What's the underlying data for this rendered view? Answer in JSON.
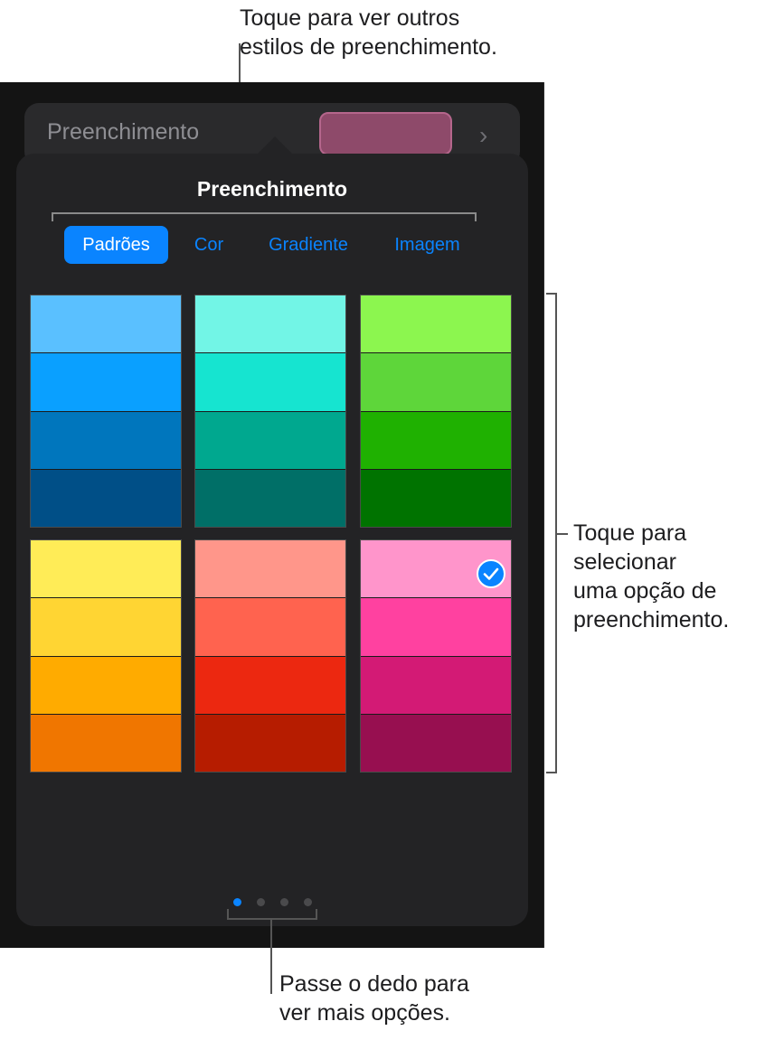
{
  "callouts": {
    "top": [
      "Toque para ver outros",
      "estilos de preenchimento."
    ],
    "right": [
      "Toque para",
      "selecionar",
      "uma opção de",
      "preenchimento."
    ],
    "bottom": [
      "Passe o dedo para",
      "ver mais opções."
    ]
  },
  "fill_row": {
    "label": "Preenchimento",
    "swatch_color": "#8e4a6a"
  },
  "popover": {
    "title": "Preenchimento",
    "tabs": [
      {
        "label": "Padrões",
        "active": true
      },
      {
        "label": "Cor",
        "active": false
      },
      {
        "label": "Gradiente",
        "active": false
      },
      {
        "label": "Imagem",
        "active": false
      }
    ],
    "swatches": [
      {
        "name": "blue",
        "colors": [
          "#5ac0ff",
          "#0aa0ff",
          "#0076bd",
          "#004f87"
        ],
        "selected": false
      },
      {
        "name": "teal",
        "colors": [
          "#72f5e6",
          "#16e4d0",
          "#00a88f",
          "#006f67"
        ],
        "selected": false
      },
      {
        "name": "green",
        "colors": [
          "#8cf64f",
          "#5ed63a",
          "#1fb101",
          "#007300"
        ],
        "selected": false
      },
      {
        "name": "yellow",
        "colors": [
          "#ffec57",
          "#ffd533",
          "#ffab00",
          "#f07600"
        ],
        "selected": false
      },
      {
        "name": "red",
        "colors": [
          "#ff968a",
          "#ff634f",
          "#ec2810",
          "#b61c00"
        ],
        "selected": false
      },
      {
        "name": "pink",
        "colors": [
          "#ff95cb",
          "#ff41a0",
          "#d31a75",
          "#970f50"
        ],
        "selected": true
      }
    ],
    "page_dots": {
      "count": 4,
      "active": 0
    }
  }
}
